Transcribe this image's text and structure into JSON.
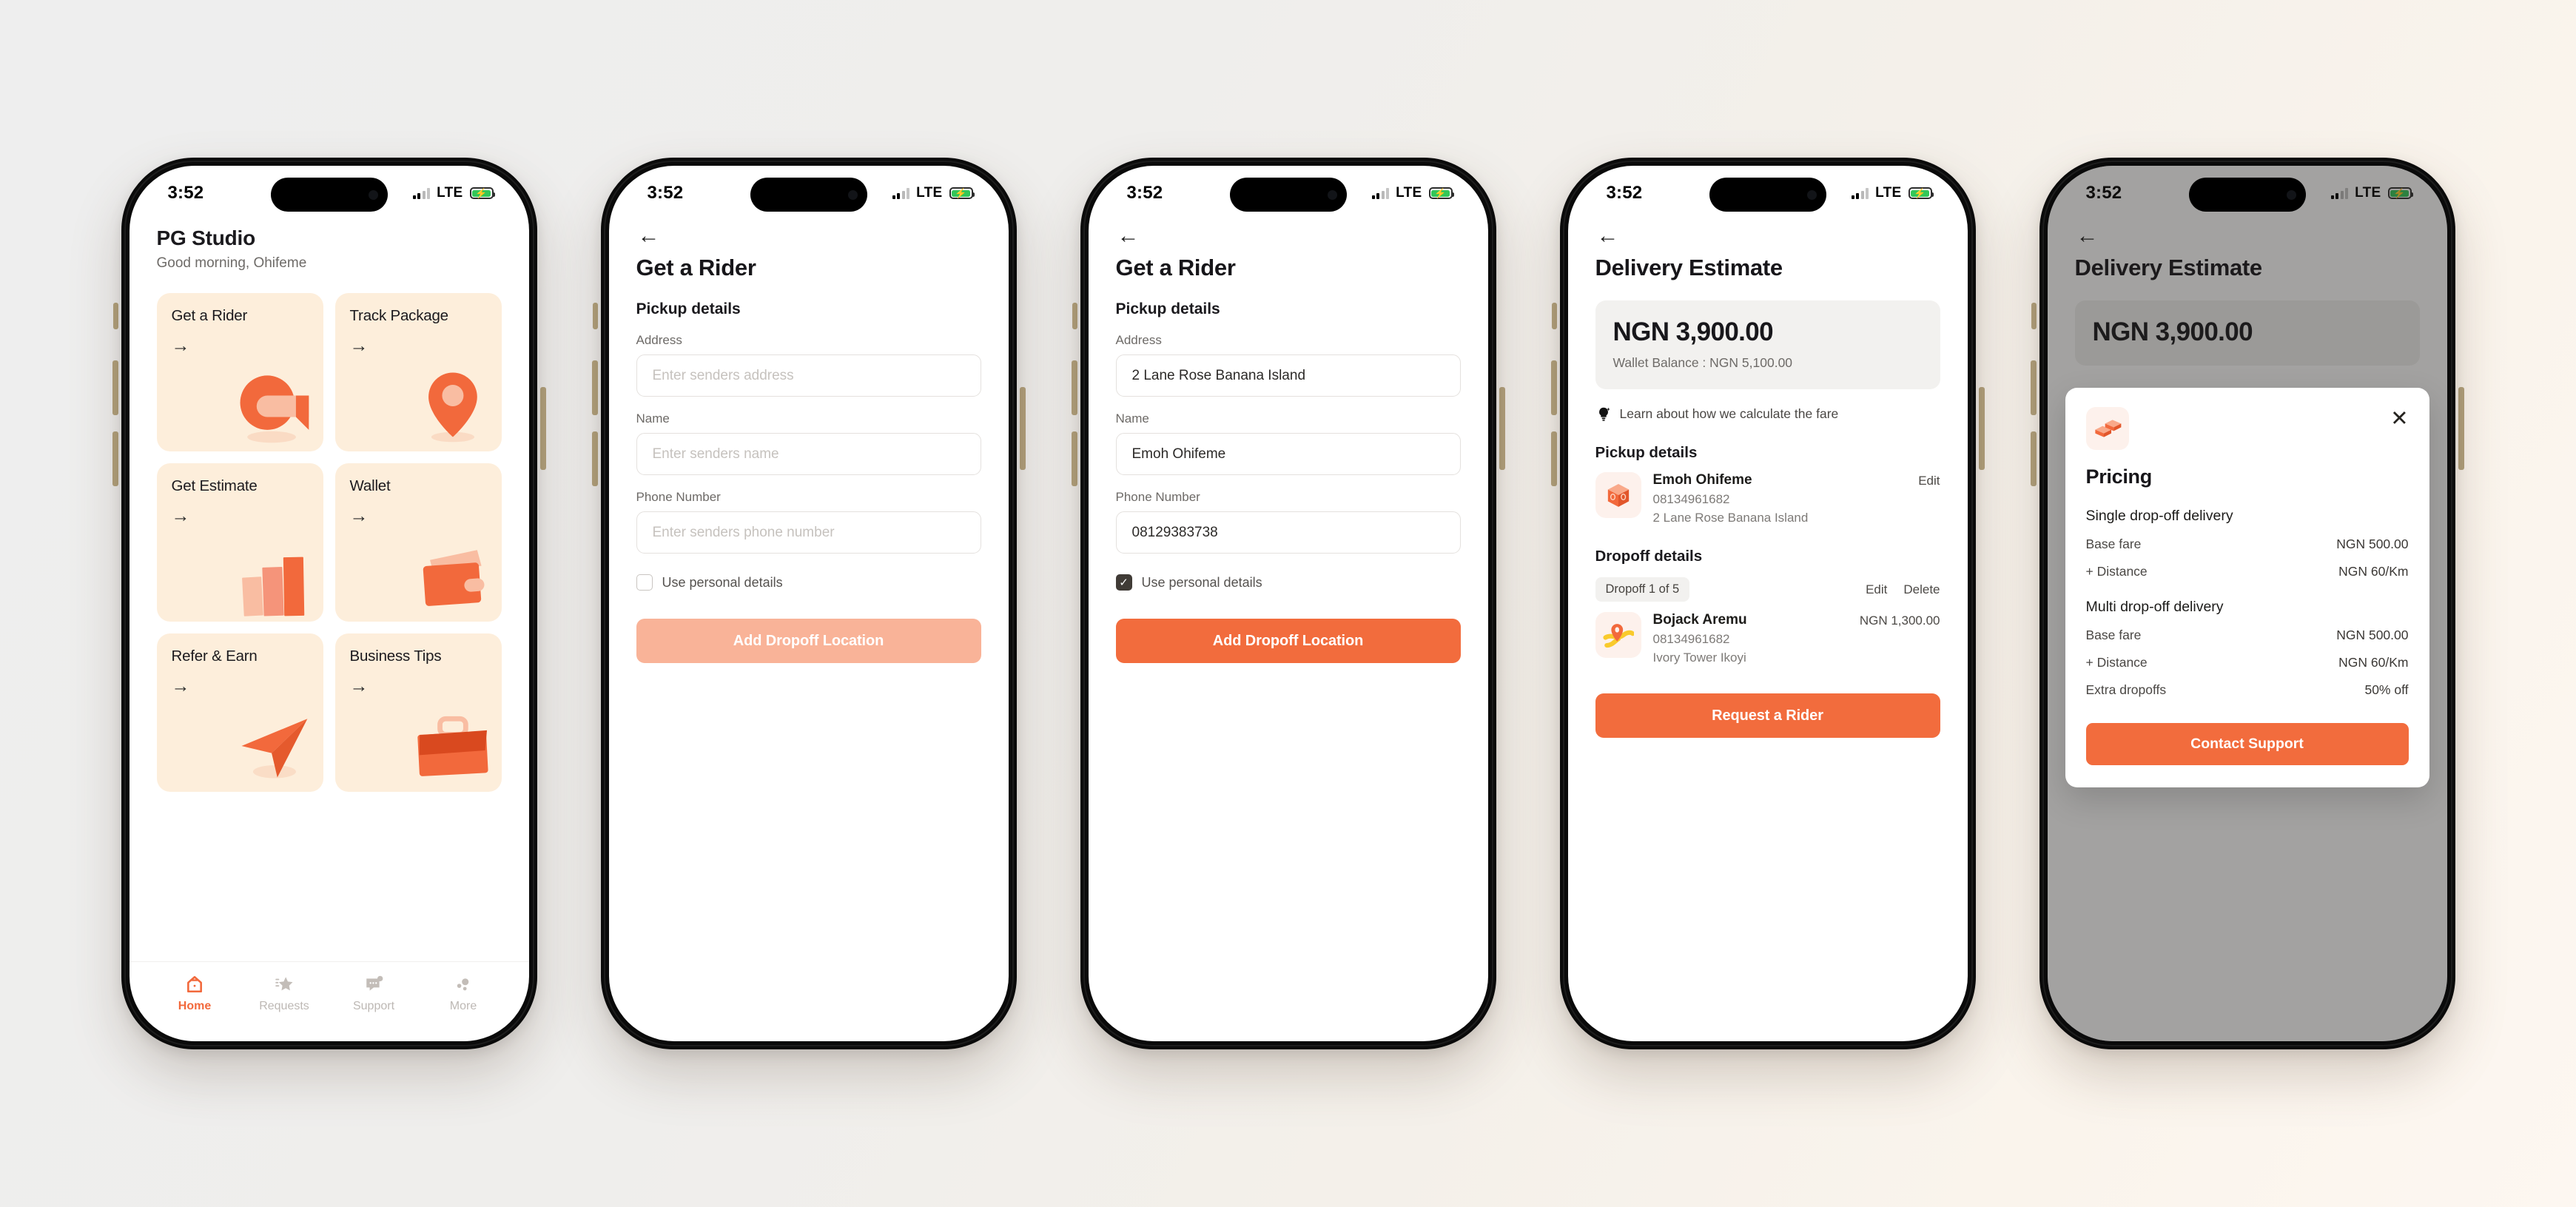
{
  "status_bar": {
    "time": "3:52",
    "network": "LTE",
    "battery_state": "charging"
  },
  "colors": {
    "accent": "#F26C3D",
    "accent_muted": "#F9B398",
    "tile_bg": "#FDEEDB",
    "surface_gray": "#F2F1EF",
    "text_primary": "#17161A",
    "text_muted": "#6E6B68"
  },
  "screen1": {
    "title": "PG Studio",
    "greeting": "Good morning, Ohifeme",
    "tiles": [
      {
        "label": "Get a Rider",
        "arrow": "→",
        "art": "helmet-icon"
      },
      {
        "label": "Track Package",
        "arrow": "→",
        "art": "map-pin-icon"
      },
      {
        "label": "Get Estimate",
        "arrow": "→",
        "art": "bar-chart-icon"
      },
      {
        "label": "Wallet",
        "arrow": "→",
        "art": "wallet-icon"
      },
      {
        "label": "Refer & Earn",
        "arrow": "→",
        "art": "paper-plane-icon"
      },
      {
        "label": "Business Tips",
        "arrow": "→",
        "art": "briefcase-icon"
      }
    ],
    "tabs": [
      {
        "label": "Home",
        "icon": "home-icon",
        "active": true
      },
      {
        "label": "Requests",
        "icon": "star-icon",
        "active": false
      },
      {
        "label": "Support",
        "icon": "chat-icon",
        "active": false
      },
      {
        "label": "More",
        "icon": "more-dots-icon",
        "active": false
      }
    ]
  },
  "screen2": {
    "title": "Get a Rider",
    "section": "Pickup details",
    "fields": [
      {
        "label": "Address",
        "placeholder": "Enter senders address",
        "value": ""
      },
      {
        "label": "Name",
        "placeholder": "Enter senders name",
        "value": ""
      },
      {
        "label": "Phone Number",
        "placeholder": "Enter senders phone number",
        "value": ""
      }
    ],
    "checkbox_label": "Use personal details",
    "checkbox_checked": false,
    "cta_label": "Add Dropoff Location",
    "cta_enabled": false
  },
  "screen3": {
    "title": "Get a Rider",
    "section": "Pickup details",
    "fields": [
      {
        "label": "Address",
        "placeholder": "Enter senders address",
        "value": "2 Lane Rose Banana Island"
      },
      {
        "label": "Name",
        "placeholder": "Enter senders name",
        "value": "Emoh Ohifeme"
      },
      {
        "label": "Phone Number",
        "placeholder": "Enter senders phone number",
        "value": "08129383738"
      }
    ],
    "checkbox_label": "Use personal details",
    "checkbox_checked": true,
    "cta_label": "Add Dropoff Location",
    "cta_enabled": true
  },
  "screen4": {
    "title": "Delivery Estimate",
    "fare_amount": "NGN 3,900.00",
    "wallet_balance": "Wallet Balance : NGN 5,100.00",
    "learn_link": "Learn about how we calculate the fare",
    "pickup_heading": "Pickup details",
    "pickup": {
      "name": "Emoh Ohifeme",
      "phone": "08134961682",
      "address": "2 Lane Rose Banana Island",
      "action": "Edit"
    },
    "dropoff_heading": "Dropoff details",
    "dropoff_chip": "Dropoff 1 of 5",
    "dropoff_actions": [
      "Edit",
      "Delete"
    ],
    "dropoff": {
      "name": "Bojack Aremu",
      "phone": "08134961682",
      "address": "Ivory Tower Ikoyi",
      "price": "NGN 1,300.00"
    },
    "cta_label": "Request a Rider"
  },
  "screen5": {
    "title": "Delivery Estimate",
    "background_fare": "NGN 3,900.00",
    "modal": {
      "icon": "money-stack-icon",
      "close_icon": "close-icon",
      "title": "Pricing",
      "groups": [
        {
          "name": "Single drop-off delivery",
          "rows": [
            {
              "label": "Base fare",
              "value": "NGN 500.00"
            },
            {
              "label": "+ Distance",
              "value": "NGN 60/Km"
            }
          ]
        },
        {
          "name": "Multi drop-off delivery",
          "rows": [
            {
              "label": "Base fare",
              "value": "NGN 500.00"
            },
            {
              "label": "+ Distance",
              "value": "NGN 60/Km"
            },
            {
              "label": "Extra dropoffs",
              "value": "50% off"
            }
          ]
        }
      ],
      "cta_label": "Contact Support"
    }
  }
}
